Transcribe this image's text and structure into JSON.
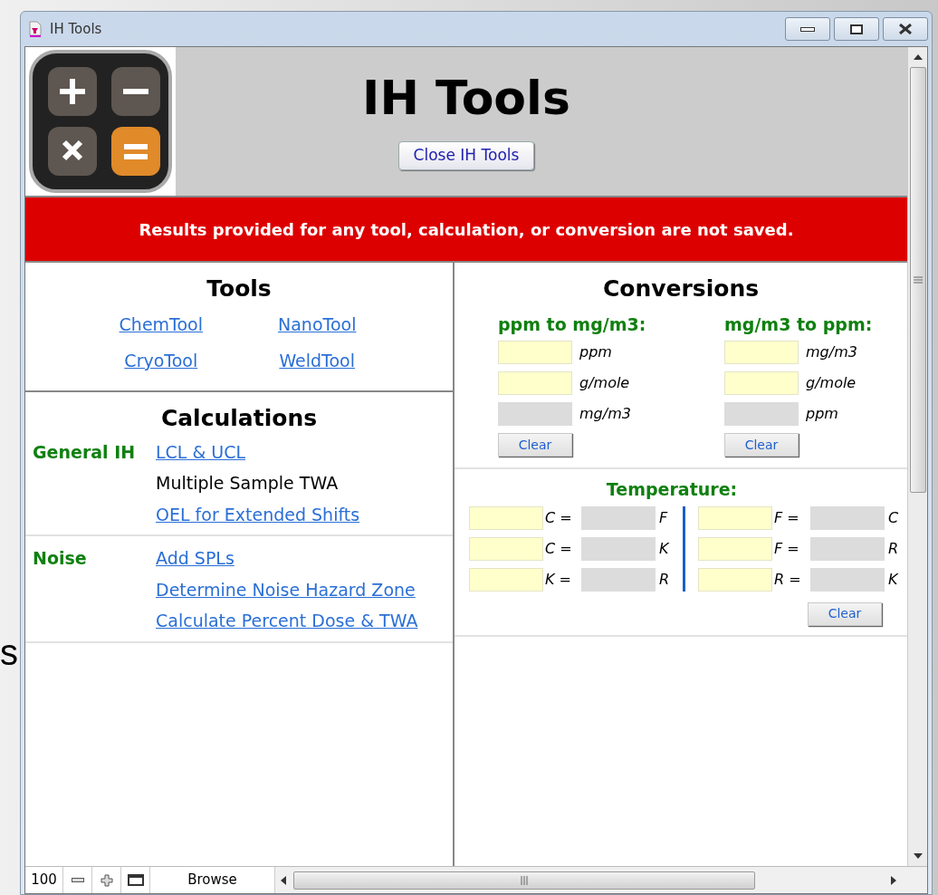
{
  "background_text": "s",
  "window": {
    "title": "IH Tools"
  },
  "header": {
    "title": "IH Tools",
    "button": "Close IH Tools"
  },
  "banner": "Results provided for any tool, calculation, or conversion are not saved.",
  "tools": {
    "heading": "Tools",
    "links": [
      "ChemTool",
      "NanoTool",
      "CryoTool",
      "WeldTool"
    ]
  },
  "calculations": {
    "heading": "Calculations",
    "groups": [
      {
        "label": "General IH",
        "items": [
          {
            "text": "LCL & UCL",
            "link": true
          },
          {
            "text": "Multiple Sample TWA",
            "link": false
          },
          {
            "text": "OEL for Extended Shifts",
            "link": true
          }
        ]
      },
      {
        "label": "Noise",
        "items": [
          {
            "text": "Add SPLs",
            "link": true
          },
          {
            "text": "Determine Noise Hazard Zone",
            "link": true
          },
          {
            "text": "Calculate Percent Dose & TWA",
            "link": true
          }
        ]
      }
    ]
  },
  "conversions": {
    "heading": "Conversions",
    "converters": [
      {
        "title": "ppm to mg/m3:",
        "rows": [
          {
            "unit": "ppm",
            "kind": "input"
          },
          {
            "unit": "g/mole",
            "kind": "input"
          },
          {
            "unit": "mg/m3",
            "kind": "result"
          }
        ],
        "button": "Clear"
      },
      {
        "title": "mg/m3 to ppm:",
        "rows": [
          {
            "unit": "mg/m3",
            "kind": "input"
          },
          {
            "unit": "g/mole",
            "kind": "input"
          },
          {
            "unit": "ppm",
            "kind": "result"
          }
        ],
        "button": "Clear"
      }
    ]
  },
  "temperature": {
    "title": "Temperature:",
    "columns": [
      [
        {
          "from": "C =",
          "to": "F"
        },
        {
          "from": "C =",
          "to": "K"
        },
        {
          "from": "K =",
          "to": "R"
        }
      ],
      [
        {
          "from": "F =",
          "to": "C"
        },
        {
          "from": "F =",
          "to": "R"
        },
        {
          "from": "R =",
          "to": "K"
        }
      ]
    ],
    "button": "Clear"
  },
  "status_bar": {
    "zoom": "100",
    "mode": "Browse"
  }
}
